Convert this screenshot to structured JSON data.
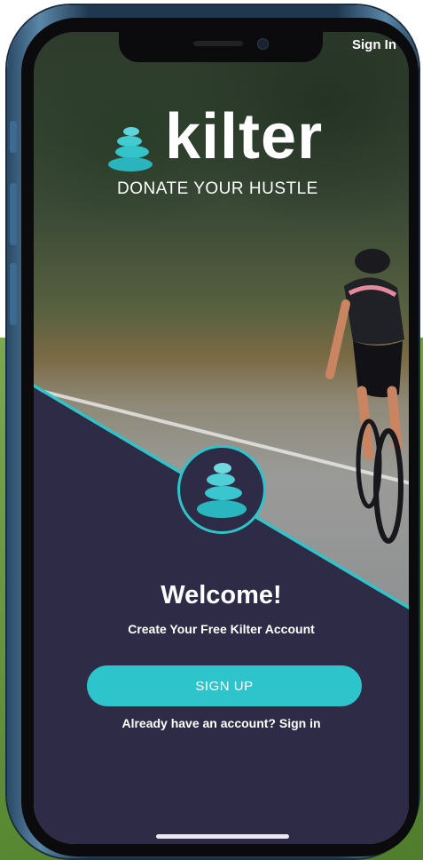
{
  "top_bar": {
    "sign_in_label": "Sign In"
  },
  "brand": {
    "name": "kilter",
    "tagline": "DONATE YOUR HUSTLE"
  },
  "welcome": {
    "title": "Welcome!",
    "subtitle": "Create Your Free Kilter Account"
  },
  "actions": {
    "sign_up_label": "SIGN UP",
    "sign_in_prompt": "Already have an account? Sign in"
  },
  "colors": {
    "accent": "#2ec4cc",
    "panel": "#2d2b45",
    "text": "#ffffff"
  },
  "icons": {
    "logo": "stacked-stones-icon",
    "emblem": "stacked-stones-icon"
  }
}
